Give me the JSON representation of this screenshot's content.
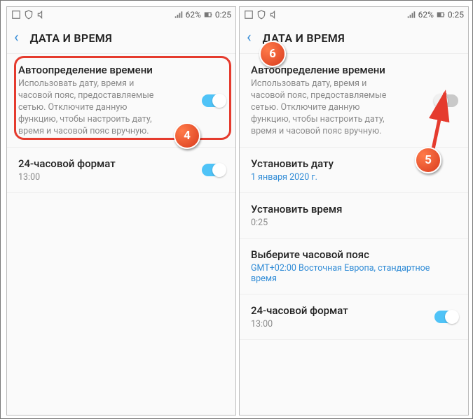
{
  "status": {
    "battery": "62%",
    "time": "0:25"
  },
  "header": {
    "title": "ДАТА И ВРЕМЯ"
  },
  "auto": {
    "title": "Автоопределение времени",
    "desc": "Использовать дату, время и часовой пояс, предоставляемые сетью. Отключите данную функцию, чтобы настроить дату, время и часовой пояс вручную."
  },
  "fmt24": {
    "title": "24-часовой формат",
    "value": "13:00"
  },
  "setDate": {
    "title": "Установить дату",
    "value": "1 января 2020 г."
  },
  "setTime": {
    "title": "Установить время",
    "value": "0:25"
  },
  "tz": {
    "title": "Выберите часовой пояс",
    "value": "GMT+02:00 Восточная Европа, стандартное время"
  },
  "badges": {
    "b4": "4",
    "b5": "5",
    "b6": "6"
  }
}
